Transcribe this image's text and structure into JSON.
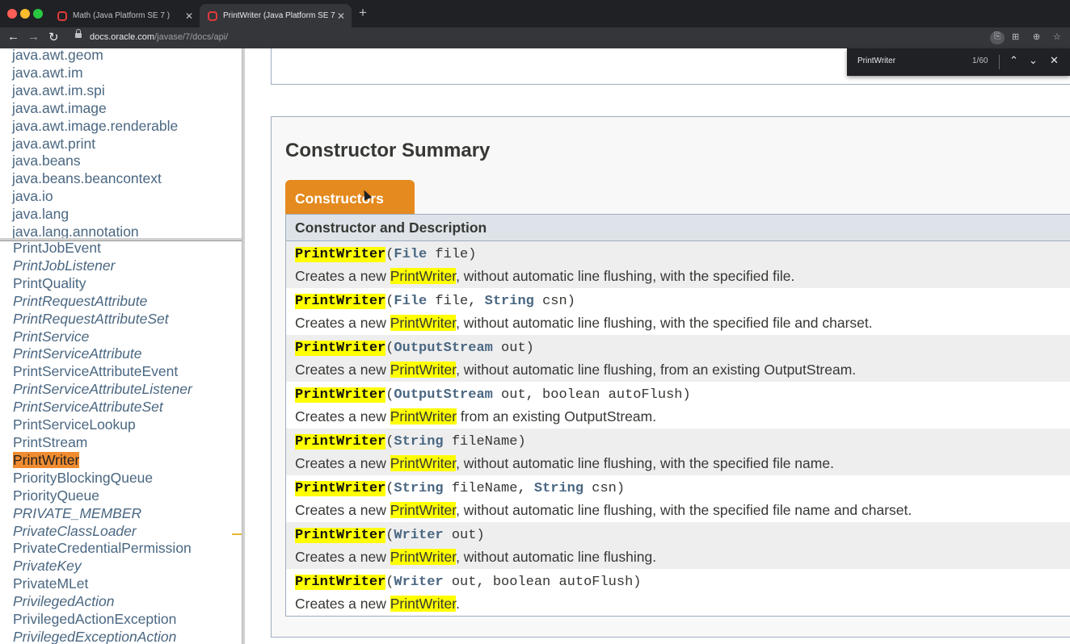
{
  "browser": {
    "tabs": [
      {
        "title": "Math (Java Platform SE 7 )",
        "active": false
      },
      {
        "title": "PrintWriter (Java Platform SE 7",
        "active": true
      }
    ],
    "url_host": "docs.oracle.com",
    "url_path": "/javase/7/docs/api/",
    "icons": {
      "back": "arrow-left-icon",
      "forward": "arrow-right-icon",
      "reload": "reload-icon",
      "lock": "lock-icon",
      "new_tab": "plus-icon"
    }
  },
  "find_bar": {
    "query": "PrintWriter",
    "count": "1/60"
  },
  "packages": [
    "java.awt.geom",
    "java.awt.im",
    "java.awt.im.spi",
    "java.awt.image",
    "java.awt.image.renderable",
    "java.awt.print",
    "java.beans",
    "java.beans.beancontext",
    "java.io",
    "java.lang",
    "java.lang.annotation"
  ],
  "classes": [
    {
      "name": "PrintJobEvent",
      "italic": false
    },
    {
      "name": "PrintJobListener",
      "italic": true
    },
    {
      "name": "PrintQuality",
      "italic": false
    },
    {
      "name": "PrintRequestAttribute",
      "italic": true
    },
    {
      "name": "PrintRequestAttributeSet",
      "italic": true
    },
    {
      "name": "PrintService",
      "italic": true
    },
    {
      "name": "PrintServiceAttribute",
      "italic": true
    },
    {
      "name": "PrintServiceAttributeEvent",
      "italic": false
    },
    {
      "name": "PrintServiceAttributeListener",
      "italic": true
    },
    {
      "name": "PrintServiceAttributeSet",
      "italic": true
    },
    {
      "name": "PrintServiceLookup",
      "italic": false
    },
    {
      "name": "PrintStream",
      "italic": false
    },
    {
      "name": "PrintWriter",
      "italic": false,
      "current": true
    },
    {
      "name": "PriorityBlockingQueue",
      "italic": false
    },
    {
      "name": "PriorityQueue",
      "italic": false
    },
    {
      "name": "PRIVATE_MEMBER",
      "italic": true
    },
    {
      "name": "PrivateClassLoader",
      "italic": true
    },
    {
      "name": "PrivateCredentialPermission",
      "italic": false
    },
    {
      "name": "PrivateKey",
      "italic": true
    },
    {
      "name": "PrivateMLet",
      "italic": false
    },
    {
      "name": "PrivilegedAction",
      "italic": true
    },
    {
      "name": "PrivilegedActionException",
      "italic": false
    },
    {
      "name": "PrivilegedExceptionAction",
      "italic": true
    }
  ],
  "summary": {
    "title": "Constructor Summary",
    "caption": "Constructors",
    "header": "Constructor and Description",
    "rows": [
      {
        "name": "PrintWriter",
        "params": [
          {
            "type": "File",
            "name": " file"
          }
        ],
        "desc_pre": "Creates a new ",
        "desc_hl": "PrintWriter",
        "desc_post": ", without automatic line flushing, with the specified file."
      },
      {
        "name": "PrintWriter",
        "params": [
          {
            "type": "File",
            "name": " file, "
          },
          {
            "type": "String",
            "name": " csn"
          }
        ],
        "desc_pre": "Creates a new ",
        "desc_hl": "PrintWriter",
        "desc_post": ", without automatic line flushing, with the specified file and charset."
      },
      {
        "name": "PrintWriter",
        "params": [
          {
            "type": "OutputStream",
            "name": " out"
          }
        ],
        "desc_pre": "Creates a new ",
        "desc_hl": "PrintWriter",
        "desc_post": ", without automatic line flushing, from an existing OutputStream."
      },
      {
        "name": "PrintWriter",
        "params": [
          {
            "type": "OutputStream",
            "name": " out, boolean autoFlush"
          }
        ],
        "desc_pre": "Creates a new ",
        "desc_hl": "PrintWriter",
        "desc_post": " from an existing OutputStream."
      },
      {
        "name": "PrintWriter",
        "params": [
          {
            "type": "String",
            "name": " fileName"
          }
        ],
        "desc_pre": "Creates a new ",
        "desc_hl": "PrintWriter",
        "desc_post": ", without automatic line flushing, with the specified file name."
      },
      {
        "name": "PrintWriter",
        "params": [
          {
            "type": "String",
            "name": " fileName, "
          },
          {
            "type": "String",
            "name": " csn"
          }
        ],
        "desc_pre": "Creates a new ",
        "desc_hl": "PrintWriter",
        "desc_post": ", without automatic line flushing, with the specified file name and charset."
      },
      {
        "name": "PrintWriter",
        "params": [
          {
            "type": "Writer",
            "name": " out"
          }
        ],
        "desc_pre": "Creates a new ",
        "desc_hl": "PrintWriter",
        "desc_post": ", without automatic line flushing."
      },
      {
        "name": "PrintWriter",
        "params": [
          {
            "type": "Writer",
            "name": " out, boolean autoFlush"
          }
        ],
        "desc_pre": "Creates a new ",
        "desc_hl": "PrintWriter",
        "desc_post": "."
      }
    ]
  },
  "colors": {
    "caption_orange": "#e48a1e",
    "current_class": "#f08c30",
    "find_highlight": "#ffff00",
    "link_blue": "#4a6782"
  }
}
